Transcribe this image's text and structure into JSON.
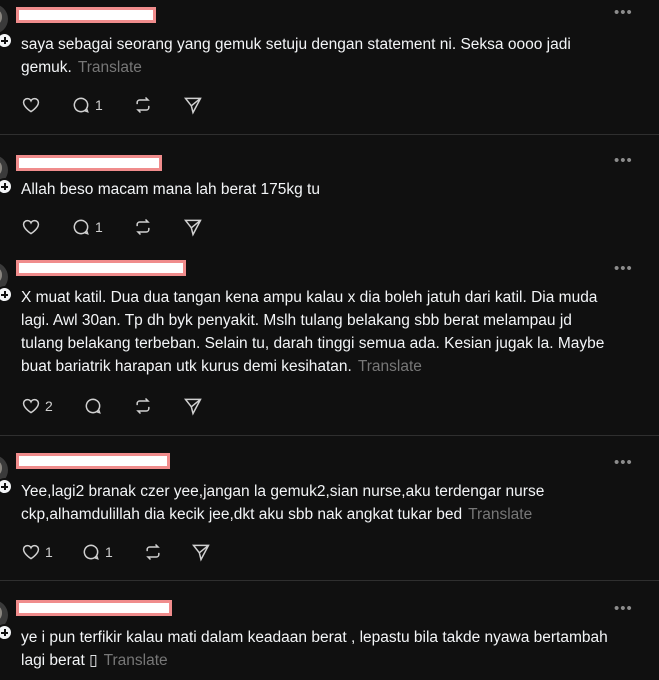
{
  "posts": [
    {
      "text": "saya sebagai seorang yang gemuk setuju dengan statement ni. Seksa oooo jadi gemuk.",
      "translate": "Translate",
      "likes": "",
      "replies": "1"
    },
    {
      "text": "Allah beso macam mana lah berat 175kg tu",
      "translate": "",
      "likes": "",
      "replies": "1"
    },
    {
      "text": "X muat katil. Dua dua tangan kena ampu kalau x dia boleh jatuh dari katil. Dia muda lagi. Awl 30an. Tp dh byk penyakit. Mslh tulang belakang sbb berat melampau jd tulang belakang terbeban. Selain tu, darah tinggi semua ada. Kesian jugak la. Maybe buat bariatrik harapan utk kurus demi kesihatan.",
      "translate": "Translate",
      "likes": "2",
      "replies": ""
    },
    {
      "text": "Yee,lagi2 branak czer yee,jangan la gemuk2,sian nurse,aku terdengar nurse ckp,alhamdulillah dia kecik jee,dkt aku sbb nak angkat tukar bed",
      "translate": "Translate",
      "likes": "1",
      "replies": "1"
    },
    {
      "text": "ye i pun terfikir kalau mati dalam keadaan berat , lepastu bila takde nyawa bertambah lagi berat ▯",
      "translate": "Translate",
      "likes": "",
      "replies": ""
    }
  ],
  "icons": {
    "like": "heart-icon",
    "reply": "comment-icon",
    "repost": "repost-icon",
    "share": "send-icon",
    "more": "more-icon"
  }
}
